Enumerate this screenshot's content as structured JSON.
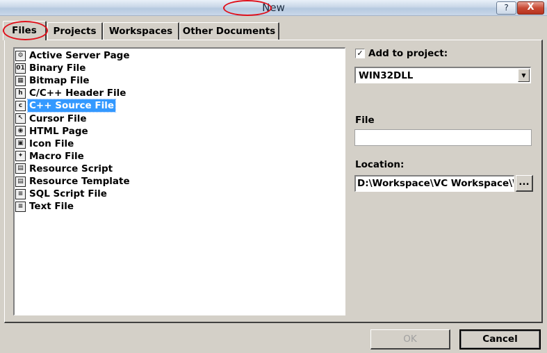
{
  "window": {
    "title": "New",
    "help_label": "?",
    "close_label": "X"
  },
  "tabs": [
    {
      "label": "Files",
      "selected": true
    },
    {
      "label": "Projects"
    },
    {
      "label": "Workspaces"
    },
    {
      "label": "Other Documents"
    }
  ],
  "file_types": [
    {
      "label": "Active Server Page",
      "icon": "asp-page-icon",
      "glyph": "⚙"
    },
    {
      "label": "Binary File",
      "icon": "binary-file-icon",
      "glyph": "01"
    },
    {
      "label": "Bitmap File",
      "icon": "bitmap-file-icon",
      "glyph": "▦"
    },
    {
      "label": "C/C++ Header File",
      "icon": "header-file-icon",
      "glyph": "h"
    },
    {
      "label": "C++ Source File",
      "icon": "source-file-icon",
      "glyph": "c",
      "selected": true
    },
    {
      "label": "Cursor File",
      "icon": "cursor-file-icon",
      "glyph": "↖"
    },
    {
      "label": "HTML Page",
      "icon": "html-page-icon",
      "glyph": "◉"
    },
    {
      "label": "Icon File",
      "icon": "icon-file-icon",
      "glyph": "▣"
    },
    {
      "label": "Macro File",
      "icon": "macro-file-icon",
      "glyph": "✦"
    },
    {
      "label": "Resource Script",
      "icon": "resource-script-icon",
      "glyph": "▤"
    },
    {
      "label": "Resource Template",
      "icon": "resource-template-icon",
      "glyph": "▤"
    },
    {
      "label": "SQL Script File",
      "icon": "sql-script-icon",
      "glyph": "≡"
    },
    {
      "label": "Text File",
      "icon": "text-file-icon",
      "glyph": "≡"
    }
  ],
  "add_to_project": {
    "label": "Add to project:",
    "checked": true,
    "check_glyph": "✓",
    "selected_value": "WIN32DLL",
    "arrow_glyph": "▼"
  },
  "file": {
    "label": "File",
    "value": ""
  },
  "location": {
    "label": "Location:",
    "value": "D:\\Workspace\\VC Workspace\\W",
    "browse_label": "..."
  },
  "buttons": {
    "ok": "OK",
    "cancel": "Cancel"
  },
  "colors": {
    "selection": "#3399ff",
    "annotation_circle": "#e0101a"
  }
}
